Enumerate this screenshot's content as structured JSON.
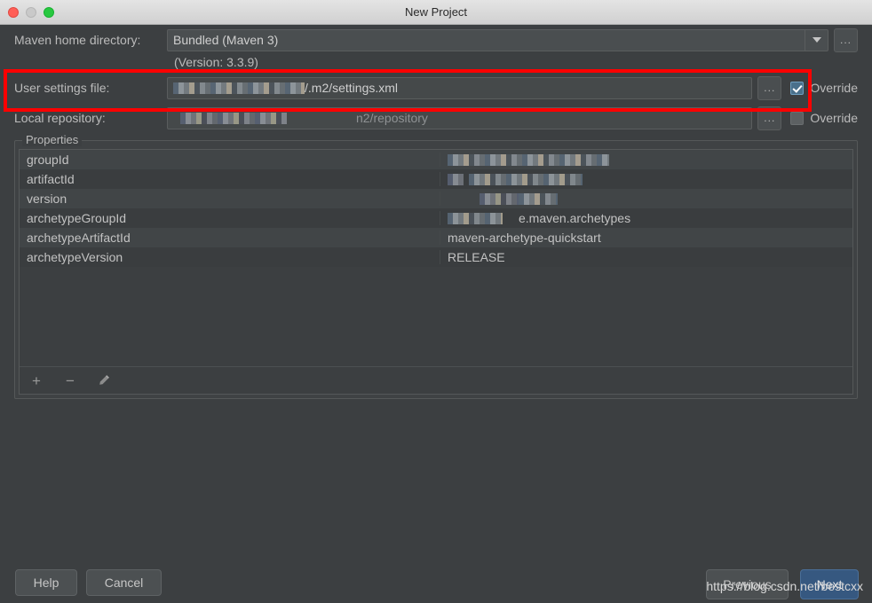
{
  "window": {
    "title": "New Project",
    "controls": {
      "close": "close-button",
      "minimize": "minimize-button",
      "maximize": "maximize-button"
    }
  },
  "form": {
    "maven_home": {
      "label": "Maven home directory:",
      "value": "Bundled (Maven 3)",
      "version_note": "(Version: 3.3.9)",
      "browse_label": "...",
      "dropdown_icon": "chevron-down-icon"
    },
    "user_settings": {
      "label": "User settings file:",
      "value": "/.m2/settings.xml",
      "redacted_prefix": true,
      "browse_label": "...",
      "override_label": "Override",
      "override_checked": true
    },
    "local_repository": {
      "label": "Local repository:",
      "value": "n2/repository",
      "redacted_prefix": true,
      "browse_label": "...",
      "override_label": "Override",
      "override_checked": false
    }
  },
  "properties": {
    "legend": "Properties",
    "rows": [
      {
        "key": "groupId",
        "value": "",
        "redacted": true
      },
      {
        "key": "artifactId",
        "value": "",
        "redacted": true
      },
      {
        "key": "version",
        "value": "",
        "redacted": true
      },
      {
        "key": "archetypeGroupId",
        "value": "e.maven.archetypes",
        "redacted": true
      },
      {
        "key": "archetypeArtifactId",
        "value": "maven-archetype-quickstart",
        "redacted": false
      },
      {
        "key": "archetypeVersion",
        "value": "RELEASE",
        "redacted": false
      }
    ],
    "toolbar": {
      "add": "+",
      "remove": "−",
      "edit": "✎"
    }
  },
  "footer": {
    "help": "Help",
    "cancel": "Cancel",
    "previous": "Previous",
    "next": "Next"
  },
  "watermark": "https://blog.csdn.net/bestcxx",
  "colors": {
    "background": "#3c3f41",
    "accent": "#365880",
    "checkbox_on": "#4a708b",
    "annotation": "#ff0000",
    "titlebar": "#e0e0e0"
  }
}
